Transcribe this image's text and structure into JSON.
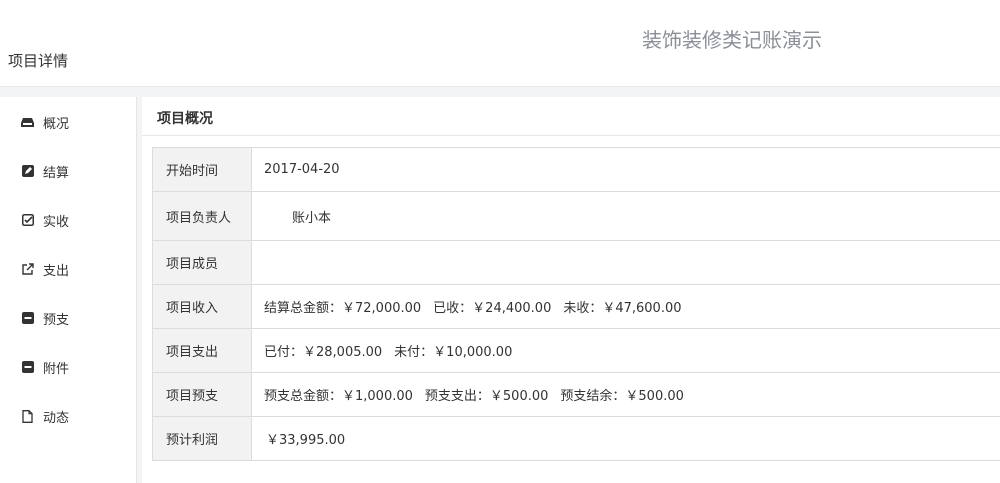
{
  "header": {
    "page_title": "项目详情",
    "app_title": "装饰装修类记账演示"
  },
  "sidebar": {
    "items": [
      {
        "label": "概况",
        "icon": "inbox-icon"
      },
      {
        "label": "结算",
        "icon": "edit-icon"
      },
      {
        "label": "实收",
        "icon": "check-square-icon"
      },
      {
        "label": "支出",
        "icon": "external-link-icon"
      },
      {
        "label": "预支",
        "icon": "minus-square-icon"
      },
      {
        "label": "附件",
        "icon": "minus-square-icon"
      },
      {
        "label": "动态",
        "icon": "file-icon"
      }
    ]
  },
  "panel": {
    "title": "项目概况",
    "rows": {
      "start_time": {
        "label": "开始时间",
        "value": "2017-04-20"
      },
      "manager": {
        "label": "项目负责人",
        "value": "账小本"
      },
      "members": {
        "label": "项目成员",
        "value": ""
      },
      "income": {
        "label": "项目收入",
        "total": "结算总金额：￥72,000.00",
        "received": "已收：￥24,400.00",
        "unreceived": "未收：￥47,600.00"
      },
      "expense": {
        "label": "项目支出",
        "paid": "已付：￥28,005.00",
        "unpaid": "未付：￥10,000.00"
      },
      "advance": {
        "label": "项目预支",
        "total": "预支总金额：￥1,000.00",
        "spent": "预支支出：￥500.00",
        "balance": "预支结余：￥500.00"
      },
      "profit": {
        "label": "预计利润",
        "value": "￥33,995.00"
      }
    }
  }
}
